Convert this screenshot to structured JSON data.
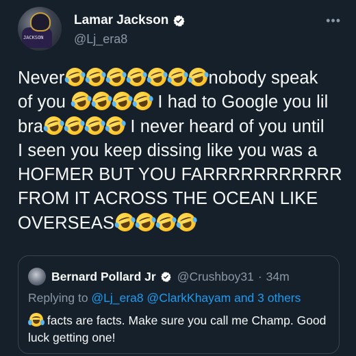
{
  "author": {
    "name": "Lamar Jackson",
    "handle": "@Lj_era8",
    "verified": true,
    "avatar_jersey_text": "JACKSON"
  },
  "more_icon": "more-horizontal-icon",
  "tweet": {
    "lines": [
      [
        "Never",
        "🤣",
        "🤣",
        "🤣",
        "🤣",
        "🤣",
        "🤣",
        "🤣",
        "nobody speak"
      ],
      [
        "of you ",
        "🤣",
        "🤣",
        "🤣",
        "🤣",
        " I had to Google you lil"
      ],
      [
        "bra",
        "🤣",
        "🤣",
        "🤣",
        "🤣",
        " I never heard of you until"
      ],
      [
        "I seen you keep dissing like you was a"
      ],
      [
        "HOFMER BUT YOU FARRRRRRRRRRR"
      ],
      [
        "FROM IT ACROSS THE OCEAN LIKE"
      ],
      [
        "OVERSEAS",
        "🤣",
        "🤣",
        "🤣",
        "🤣"
      ]
    ]
  },
  "quoted_tweet": {
    "name": "Bernard Pollard Jr",
    "handle": "@Crushboy31",
    "separator": "·",
    "time": "34m",
    "replying_prefix": "Replying to ",
    "replying_to": "@Lj_era8 @ClarkKhayam and 3 others",
    "emoji": "😂",
    "text": " facts are facts. Make sure you call me Champ. Good luck getting one!"
  },
  "colors": {
    "background": "#15202b",
    "text": "#f7f9f9",
    "secondary": "#8b98a5",
    "link": "#1d9bf0",
    "border": "#38444d",
    "verified": "#1d9bf0"
  }
}
